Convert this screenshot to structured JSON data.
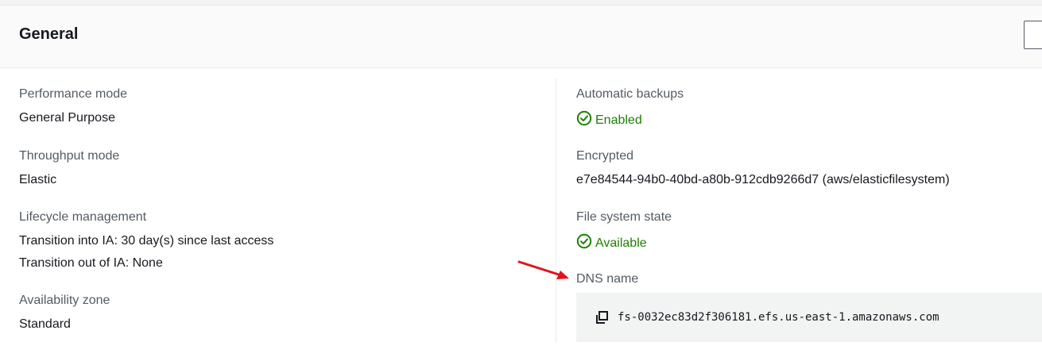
{
  "panel": {
    "title": "General"
  },
  "left_column": {
    "performance_mode": {
      "label": "Performance mode",
      "value": "General Purpose"
    },
    "throughput_mode": {
      "label": "Throughput mode",
      "value": "Elastic"
    },
    "lifecycle_management": {
      "label": "Lifecycle management",
      "line1": "Transition into IA: 30 day(s) since last access",
      "line2": "Transition out of IA: None"
    },
    "availability_zone": {
      "label": "Availability zone",
      "value": "Standard"
    }
  },
  "right_column": {
    "automatic_backups": {
      "label": "Automatic backups",
      "value": "Enabled",
      "icon": "check-circle-icon"
    },
    "encrypted": {
      "label": "Encrypted",
      "value": "e7e84544-94b0-40bd-a80b-912cdb9266d7 (aws/elasticfilesystem)"
    },
    "file_system_state": {
      "label": "File system state",
      "value": "Available",
      "icon": "check-circle-icon"
    },
    "dns_name": {
      "label": "DNS name",
      "value": "fs-0032ec83d2f306181.efs.us-east-1.amazonaws.com",
      "copy_icon": "copy-icon"
    }
  },
  "colors": {
    "success": "#1d8102",
    "label": "#545b64",
    "text": "#16191f",
    "annotation_arrow": "#e3121b"
  }
}
